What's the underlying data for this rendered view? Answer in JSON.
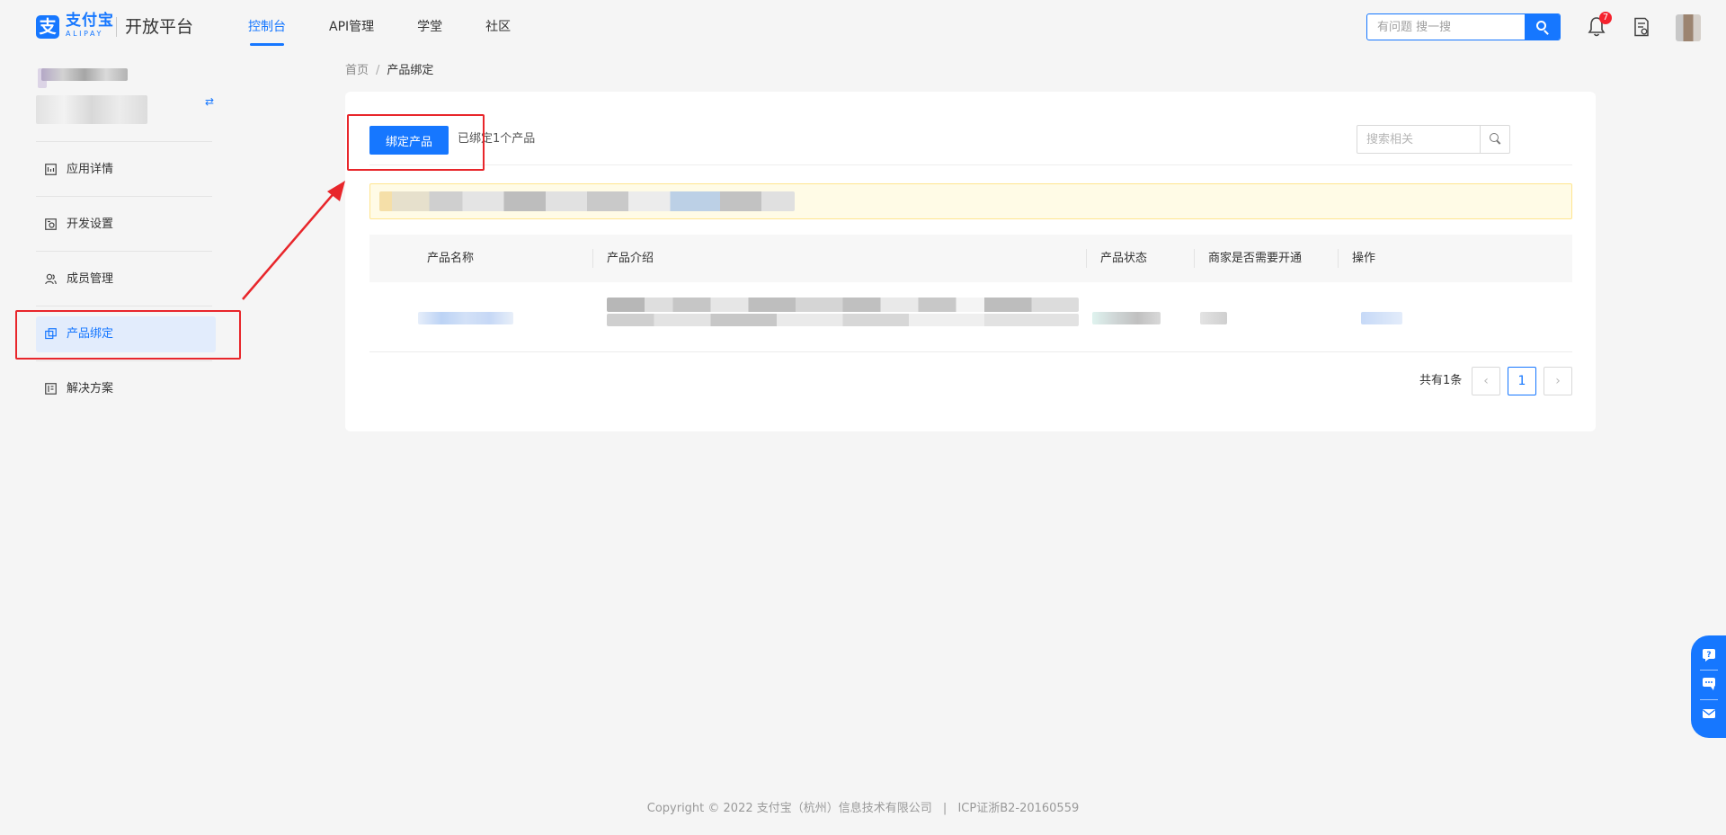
{
  "brand": {
    "logo_glyph": "支",
    "name_cn": "支付宝",
    "name_en": "ALIPAY",
    "platform": "开放平台",
    "accent": "#1677ff"
  },
  "topnav": {
    "items": [
      {
        "label": "控制台",
        "active": true
      },
      {
        "label": "API管理",
        "active": false
      },
      {
        "label": "学堂",
        "active": false
      },
      {
        "label": "社区",
        "active": false
      }
    ],
    "search_placeholder": "有问题 搜一搜",
    "search_icon": "search-icon",
    "notification_count": "7"
  },
  "sidebar": {
    "switch_glyph": "⇄",
    "items": [
      {
        "label": "应用详情",
        "icon": "app-detail-icon",
        "active": false
      },
      {
        "label": "开发设置",
        "icon": "dev-settings-icon",
        "active": false
      },
      {
        "label": "成员管理",
        "icon": "members-icon",
        "active": false
      },
      {
        "label": "产品绑定",
        "icon": "product-bind-icon",
        "active": true
      },
      {
        "label": "解决方案",
        "icon": "solution-icon",
        "active": false
      }
    ]
  },
  "breadcrumb": {
    "home": "首页",
    "separator": "/",
    "current": "产品绑定"
  },
  "toolbar": {
    "bind_button_label": "绑定产品",
    "bound_count_text": "已绑定1个产品",
    "search_placeholder": "搜索相关"
  },
  "table": {
    "columns": [
      "产品名称",
      "产品介绍",
      "产品状态",
      "商家是否需要开通",
      "操作"
    ]
  },
  "pagination": {
    "total_text": "共有1条",
    "prev": "‹",
    "current_page": "1",
    "next": "›"
  },
  "footer": {
    "copyright": "Copyright © 2022 支付宝（杭州）信息技术有限公司",
    "divider": "|",
    "icp": "ICP证浙B2-20160559"
  },
  "colors": {
    "annotation_red": "#e8262b",
    "notice_bg": "#fffbe6",
    "notice_border": "#ffe58f"
  }
}
